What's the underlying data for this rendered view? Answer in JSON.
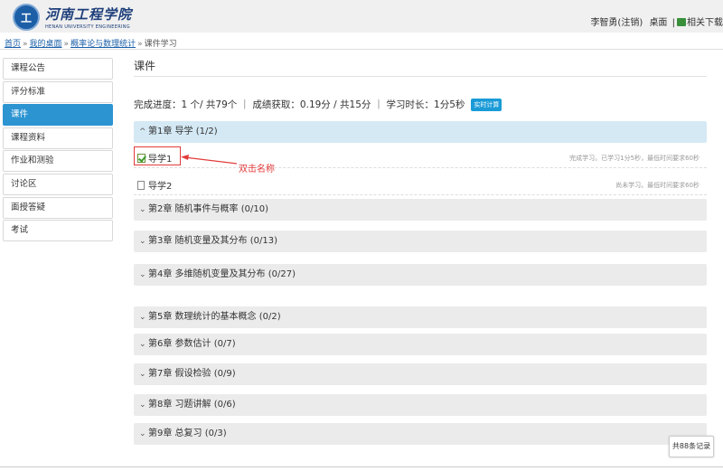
{
  "header": {
    "logo_seal": "工",
    "logo_cn": "河南工程学院",
    "logo_en": "HENAN UNIVERSITY ENGINEERING",
    "user": "李智勇(注销)",
    "desktop": "桌面",
    "divider": "|",
    "downloads": "相关下载"
  },
  "breadcrumb": {
    "items": [
      "首页",
      "我的桌面",
      "概率论与数理统计",
      "课件学习"
    ],
    "separator": "»"
  },
  "sidebar": {
    "items": [
      {
        "label": "课程公告",
        "active": false
      },
      {
        "label": "评分标准",
        "active": false
      },
      {
        "label": "课件",
        "active": true
      },
      {
        "label": "课程资料",
        "active": false
      },
      {
        "label": "作业和测验",
        "active": false
      },
      {
        "label": "讨论区",
        "active": false
      },
      {
        "label": "面授答疑",
        "active": false
      },
      {
        "label": "考试",
        "active": false
      }
    ]
  },
  "main": {
    "title": "课件",
    "progress_text": "完成进度：1 个/ 共79个 ｜ 成绩获取：0.19分 / 共15分 ｜ 学习时长：1分5秒",
    "calc_button": "实时计算",
    "chapter1": {
      "label": "第1章 导学 (1/2)"
    },
    "lessons": [
      {
        "name": "导学1",
        "status": "完成学习。已学习1分5秒，最低时间要求60秒"
      },
      {
        "name": "导学2",
        "status": "尚未学习。最低时间要求60秒"
      }
    ],
    "chapters": [
      {
        "label": "第2章 随机事件与概率 (0/10)"
      },
      {
        "label": "第3章 随机变量及其分布 (0/13)"
      },
      {
        "label": "第4章 多维随机变量及其分布 (0/27)"
      },
      {
        "label": "第5章 数理统计的基本概念 (0/2)"
      },
      {
        "label": "第6章 参数估计 (0/7)"
      },
      {
        "label": "第7章 假设检验 (0/9)"
      },
      {
        "label": "第8章 习题讲解 (0/6)"
      },
      {
        "label": "第9章 总复习 (0/3)"
      }
    ],
    "annotation": "双击名称",
    "records": "共88条记录"
  },
  "colors": {
    "accent": "#2d94d2",
    "annotation": "#e23b3b",
    "chapter_open": "#d4e9f4"
  }
}
